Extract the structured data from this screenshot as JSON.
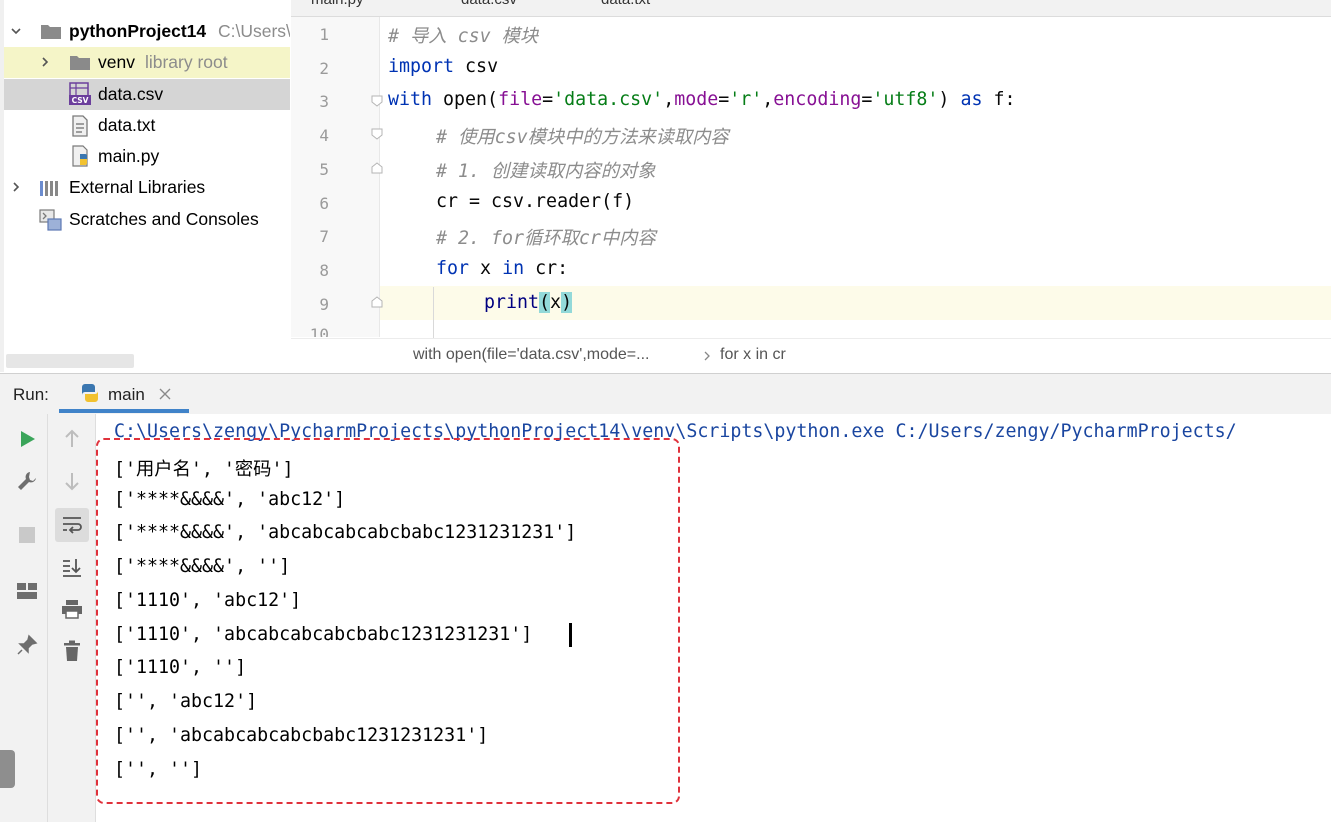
{
  "project_tree": {
    "root": {
      "name": "pythonProject14",
      "path": "C:\\Users\\"
    },
    "items": [
      {
        "name": "venv",
        "note": "library root"
      },
      {
        "name": "data.csv"
      },
      {
        "name": "data.txt"
      },
      {
        "name": "main.py"
      }
    ],
    "external_libraries": "External Libraries",
    "scratches": "Scratches and Consoles"
  },
  "editor": {
    "line_numbers": [
      "1",
      "2",
      "3",
      "4",
      "5",
      "6",
      "7",
      "8",
      "9",
      "10"
    ],
    "tabs": [
      "main.py",
      "data.csv",
      "data.txt"
    ],
    "breadcrumb": {
      "item1": "with open(file='data.csv',mode=...",
      "item2": "for x in cr"
    },
    "code": {
      "l1": "# 导入 csv 模块",
      "l2_kw": "import",
      "l2_rest": " csv",
      "l3_kw": "with",
      "l3_fn": " open(",
      "l3_p1": "file",
      "l3_eq1": "=",
      "l3_s1": "'data.csv'",
      "l3_c1": ",",
      "l3_p2": "mode",
      "l3_eq2": "=",
      "l3_s2": "'r'",
      "l3_c2": ",",
      "l3_p3": "encoding",
      "l3_eq3": "=",
      "l3_s3": "'utf8'",
      "l3_close": ") ",
      "l3_as": "as",
      "l3_f": " f:",
      "l4": "# 使用csv模块中的方法来读取内容",
      "l5": "# 1. 创建读取内容的对象",
      "l6": "cr = csv.reader(f)",
      "l7": "# 2. for循环取cr中内容",
      "l8_kw1": "for",
      "l8_mid": " x ",
      "l8_kw2": "in",
      "l8_rest": " cr:",
      "l9_fn": "print",
      "l9_open": "(",
      "l9_arg": "x",
      "l9_close": ")"
    }
  },
  "run": {
    "label": "Run:",
    "tab": "main",
    "command": "C:\\Users\\zengy\\PycharmProjects\\pythonProject14\\venv\\Scripts\\python.exe C:/Users/zengy/PycharmProjects/",
    "output": [
      "['用户名', '密码']",
      "['****&&&&', 'abc12']",
      "['****&&&&', 'abcabcabcabcbabc1231231231']",
      "['****&&&&', '']",
      "['1110', 'abc12']",
      "['1110', 'abcabcabcabcbabc1231231231']",
      "['1110', '']",
      "['', 'abc12']",
      "['', 'abcabcabcabcbabc1231231231']",
      "['', '']"
    ]
  },
  "colors": {
    "keyword": "#0033b3",
    "string": "#067d17",
    "param": "#871094",
    "comment": "#8c8c8c",
    "highlight_box": "#e0323c",
    "run_accent": "#4083c9"
  },
  "icons": [
    "chevron-down-icon",
    "chevron-right-icon",
    "folder-icon",
    "csv-file-icon",
    "text-file-icon",
    "python-file-icon",
    "libraries-icon",
    "scratches-icon",
    "python-tab-icon",
    "close-icon",
    "run-icon",
    "wrench-icon",
    "stop-icon",
    "layout-icon",
    "pin-icon",
    "arrow-up-icon",
    "arrow-down-icon",
    "soft-wrap-icon",
    "scroll-end-icon",
    "print-icon",
    "trash-icon"
  ]
}
